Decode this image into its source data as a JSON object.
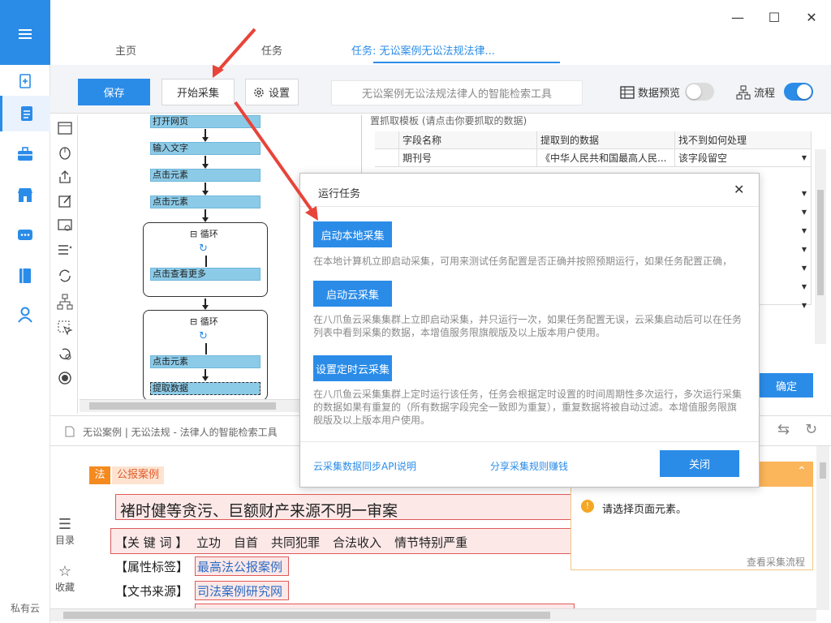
{
  "rail": {
    "footer": "私有云",
    "icons": [
      "menu-icon",
      "new-task-icon",
      "task-list-icon",
      "toolbox-icon",
      "store-icon",
      "message-icon",
      "book-icon",
      "user-icon"
    ]
  },
  "tabs": {
    "home": "主页",
    "tasks": "任务",
    "current": "任务: 无讼案例无讼法规法律..."
  },
  "window": {
    "minimize": "—",
    "maximize": "☐",
    "close": "✕"
  },
  "toolbar": {
    "save": "保存",
    "start_collect": "开始采集",
    "settings": "设置",
    "task_name": "无讼案例无讼法规法律人的智能检索工具",
    "data_preview": "数据预览",
    "flow": "流程",
    "data_preview_on": false,
    "flow_on": true
  },
  "workflow": {
    "nodes": {
      "open_page": "打开网页",
      "input_text": "输入文字",
      "click1": "点击元素",
      "click2": "点击元素",
      "loop1_title": "循环",
      "click_more": "点击查看更多",
      "loop2_title": "循环",
      "click3": "点击元素",
      "extract": "提取数据"
    }
  },
  "data_table": {
    "caption": "置抓取模板 (请点击你要抓取的数据)",
    "headers": [
      "字段名称",
      "提取到的数据",
      "找不到如何处理"
    ],
    "rows": [
      [
        "期刊号",
        "《中华人民共和国最高人民...",
        "该字段留空"
      ]
    ],
    "confirm": "确定"
  },
  "browser": {
    "address": "无讼案例 | 无讼法规 - 法律人的智能检索工具",
    "badge": "法",
    "badge_text": "公报案例",
    "title": "褚时健等贪污、巨额财产来源不明一审案",
    "keywords_label": "【关 键 词 】",
    "keywords": [
      "立功",
      "自首",
      "共同犯罪",
      "合法收入",
      "情节特别严重"
    ],
    "attr_label": "【属性标签】",
    "attr_value": "最高法公报案例",
    "source_label": "【文书来源】",
    "source_value": "司法案例研究网",
    "toc": "目录",
    "favorite": "收藏"
  },
  "modal": {
    "title": "运行任务",
    "local_btn": "启动本地采集",
    "local_desc": "在本地计算机立即启动采集，可用来测试任务配置是否正确并按照预期运行，如果任务配置正确，",
    "cloud_btn": "启动云采集",
    "cloud_desc": "在八爪鱼云采集集群上立即启动采集，并只运行一次，如果任务配置无误，云采集启动后可以在任务列表中看到采集的数据，本增值服务限旗舰版及以上版本用户使用。",
    "schedule_btn": "设置定时云采集",
    "schedule_desc": "在八爪鱼云采集集群上定时运行该任务，任务会根据定时设置的时间周期性多次运行，多次运行采集的数据如果有重复的（所有数据字段完全一致即为重复），重复数据将被自动过滤。本增值服务限旗舰版及以上版本用户使用。",
    "api_link": "云采集数据同步API说明",
    "share_link": "分享采集规则赚钱",
    "close_btn": "关闭"
  },
  "hint": {
    "message": "请选择页面元素。",
    "link": "查看采集流程"
  },
  "colors": {
    "accent": "#2b8ce8",
    "annotation": "#e8443a",
    "badge": "#f58a1f"
  }
}
